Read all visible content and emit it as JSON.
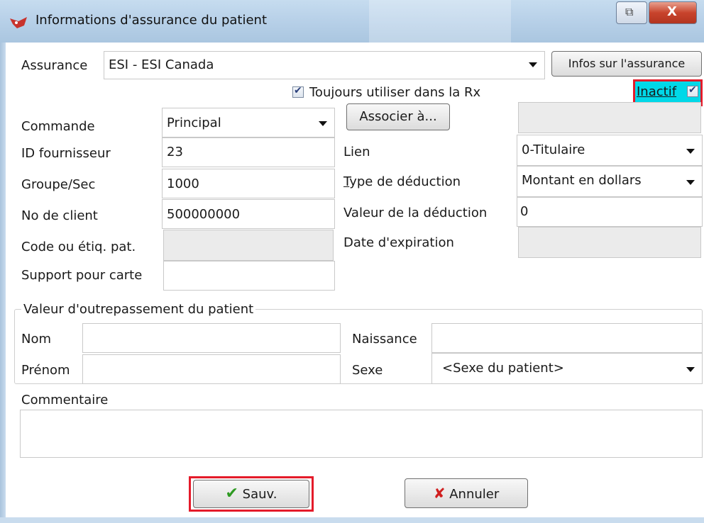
{
  "window": {
    "title": "Informations d'assurance du patient"
  },
  "insurance": {
    "label": "Assurance",
    "value": "ESI - ESI Canada",
    "info_button": "Infos sur l'assurance"
  },
  "always_use": {
    "label": "Toujours utiliser dans la Rx",
    "checked": true
  },
  "inactive": {
    "label": "Inactif",
    "checked": true
  },
  "left": {
    "order_label": "Commande",
    "order_value": "Principal",
    "provider_id_label": "ID fournisseur",
    "provider_id_value": "23",
    "group_label": "Groupe/Sec",
    "group_value": "1000",
    "client_no_label": "No de client",
    "client_no_value": "500000000",
    "code_label": "Code ou étiq. pat.",
    "card_label": "Support pour carte"
  },
  "right": {
    "associate_button": "Associer à...",
    "link_label": "Lien",
    "link_value": "0-Titulaire",
    "deduction_type_label": "Type de déduction",
    "deduction_type_value": "Montant en dollars",
    "deduction_value_label": "Valeur de la déduction",
    "deduction_value_value": "0",
    "expiry_label": "Date d'expiration"
  },
  "override": {
    "legend": "Valeur d'outrepassement du patient",
    "name_label": "Nom",
    "firstname_label": "Prénom",
    "birth_label": "Naissance",
    "sex_label": "Sexe",
    "sex_value": "<Sexe du patient>"
  },
  "comment": {
    "label": "Commentaire"
  },
  "buttons": {
    "save": "Sauv.",
    "cancel": "Annuler"
  },
  "colors": {
    "highlight_red": "#e41b2a",
    "inactive_bg": "#00d8e8",
    "save_check": "#2e9a22",
    "cancel_x": "#d01f1f"
  }
}
